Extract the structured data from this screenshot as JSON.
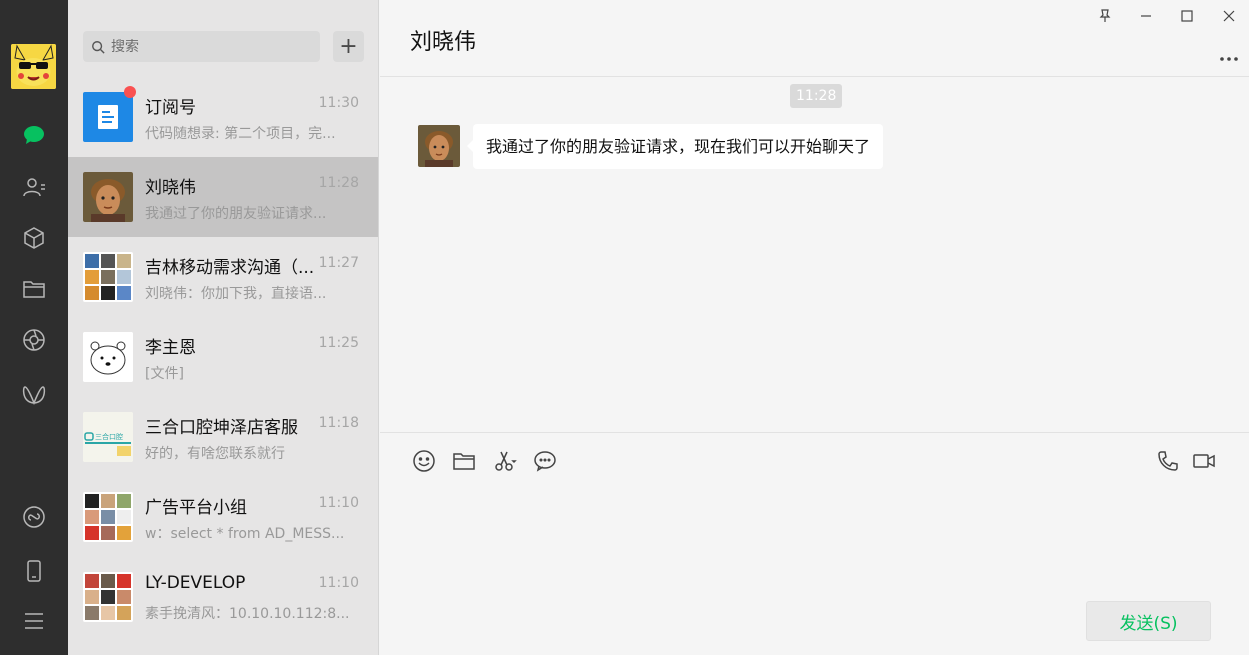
{
  "window": {
    "title": "刘晓伟"
  },
  "colors": {
    "accent": "#07c160",
    "badge": "#fa5151",
    "rail_bg": "#2e2e2e"
  },
  "rail": {
    "items": [
      {
        "icon": "chat-icon",
        "active": true
      },
      {
        "icon": "contacts-icon"
      },
      {
        "icon": "favorites-cube-icon"
      },
      {
        "icon": "folder-icon"
      },
      {
        "icon": "moments-shutter-icon"
      },
      {
        "icon": "miniprogram-icon"
      },
      {
        "icon": "mini-app-link-icon"
      },
      {
        "icon": "phone-device-icon"
      },
      {
        "icon": "menu-icon"
      }
    ]
  },
  "search": {
    "placeholder": "搜索"
  },
  "add_button": {
    "label": "+"
  },
  "chats": [
    {
      "name": "订阅号",
      "time": "11:30",
      "preview": "代码随想录: 第二个项目，完...",
      "unread_dot": true
    },
    {
      "name": "刘晓伟",
      "time": "11:28",
      "preview": "我通过了你的朋友验证请求...",
      "active": true
    },
    {
      "name": "吉林移动需求沟通（...",
      "time": "11:27",
      "preview": "刘晓伟：你加下我，直接语..."
    },
    {
      "name": "李主恩",
      "time": "11:25",
      "preview": "[文件]"
    },
    {
      "name": "三合口腔坤泽店客服",
      "time": "11:18",
      "preview": "好的，有啥您联系就行"
    },
    {
      "name": "广告平台小组",
      "time": "11:10",
      "preview": "w：select * from AD_MESS..."
    },
    {
      "name": "LY-DEVELOP",
      "time": "11:10",
      "preview": "素手挽清风：10.10.10.112:8..."
    }
  ],
  "conversation": {
    "title": "刘晓伟",
    "timestamp": "11:28",
    "messages": [
      {
        "from": "刘晓伟",
        "text": "我通过了你的朋友验证请求，现在我们可以开始聊天了"
      }
    ]
  },
  "composer": {
    "tools": [
      "emoji-icon",
      "folder-icon",
      "scissors-screenshot-icon",
      "chat-history-icon"
    ],
    "right_tools": [
      "voice-call-icon",
      "video-call-icon"
    ],
    "send_label": "发送(S)"
  },
  "logo_text": {
    "dental": "三合口腔"
  }
}
